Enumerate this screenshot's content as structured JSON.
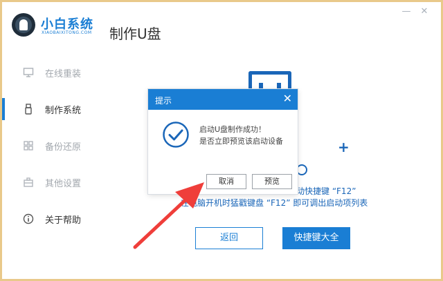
{
  "app": {
    "name": "小白系统",
    "subtitle": "XIAOBAIXITONG.COM",
    "page_title": "制作U盘",
    "controls": {
      "minimize": "—",
      "close": "✕"
    }
  },
  "sidebar": {
    "items": [
      {
        "label": "在线重装",
        "icon": "monitor-icon"
      },
      {
        "label": "制作系统",
        "icon": "usb-icon",
        "active": true
      },
      {
        "label": "备份还原",
        "icon": "grid-icon"
      },
      {
        "label": "其他设置",
        "icon": "toolbox-icon"
      },
      {
        "label": "关于帮助",
        "icon": "info-icon"
      }
    ]
  },
  "main": {
    "plus": "+",
    "line1": "动快捷键 “F12”",
    "line2": "在电脑开机时猛戳键盘 “F12” 即可调出启动项列表",
    "back_button": "返回",
    "shortcuts_button": "快捷键大全"
  },
  "dialog": {
    "title": "提示",
    "close": "✕",
    "message_line1": "启动U盘制作成功！",
    "message_line2": "是否立即预览该启动设备",
    "cancel": "取消",
    "preview": "预览"
  },
  "colors": {
    "accent": "#1a7ed4",
    "icon_blue": "#1a66b8",
    "arrow": "#ef3e3a",
    "frame": "#e9c98a"
  }
}
